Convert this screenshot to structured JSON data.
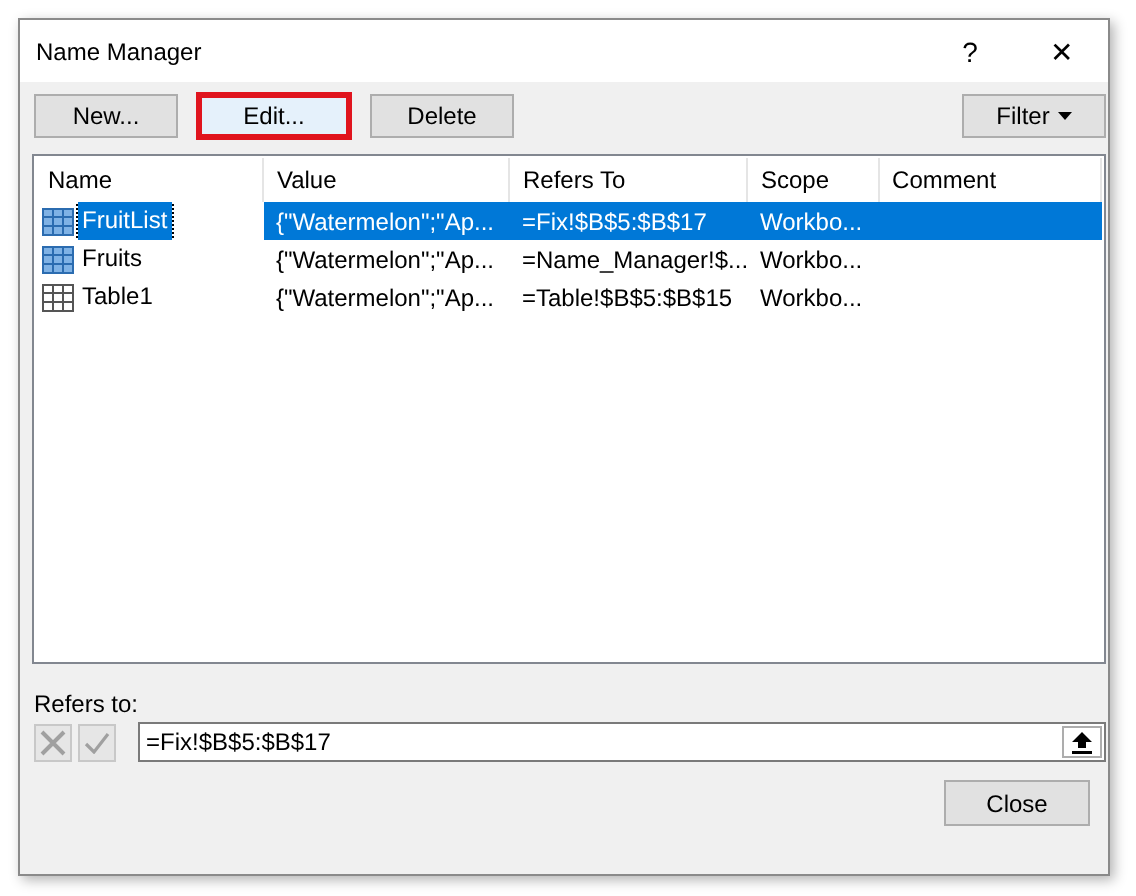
{
  "window": {
    "title": "Name Manager",
    "help": "?",
    "close": "✕"
  },
  "toolbar": [
    {
      "label": "New...",
      "highlighted": false,
      "dropdown": false
    },
    {
      "label": "Edit...",
      "highlighted": true,
      "dropdown": false
    },
    {
      "label": "Delete",
      "highlighted": false,
      "dropdown": false
    },
    {
      "label": "Filter",
      "highlighted": false,
      "dropdown": true
    }
  ],
  "table": {
    "columns": [
      "Name",
      "Value",
      "Refers To",
      "Scope",
      "Comment"
    ],
    "rows": [
      {
        "kind": "name",
        "selected": true,
        "cells": [
          "FruitList",
          "{\"Watermelon\";\"Ap...",
          "=Fix!$B$5:$B$17",
          "Workbo...",
          ""
        ]
      },
      {
        "kind": "name",
        "selected": false,
        "cells": [
          "Fruits",
          "{\"Watermelon\";\"Ap...",
          "=Name_Manager!$...",
          "Workbo...",
          ""
        ]
      },
      {
        "kind": "table",
        "selected": false,
        "cells": [
          "Table1",
          "{\"Watermelon\";\"Ap...",
          "=Table!$B$5:$B$15",
          "Workbo...",
          ""
        ]
      }
    ]
  },
  "refers_to": {
    "label": "Refers to:",
    "value": "=Fix!$B$5:$B$17",
    "cancel_disabled": true,
    "confirm_disabled": true
  },
  "buttons": [
    "Close"
  ]
}
